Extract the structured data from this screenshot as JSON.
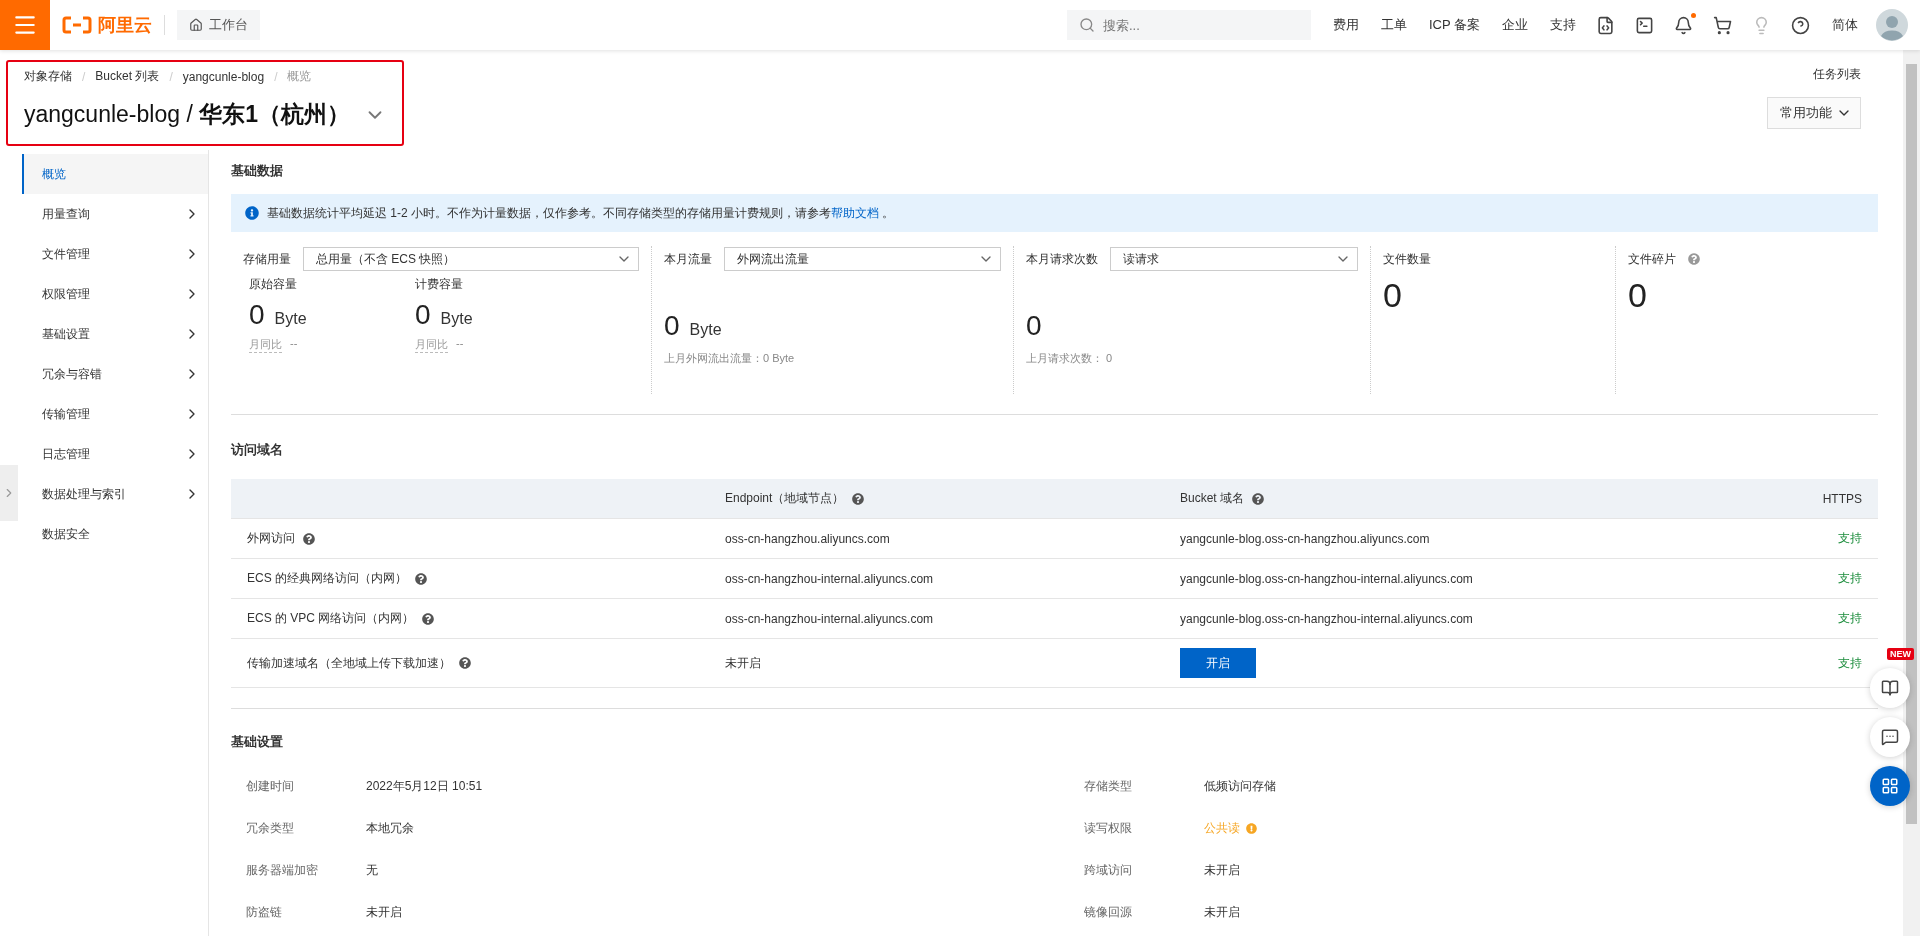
{
  "topbar": {
    "logo_text": "阿里云",
    "workbench": "工作台",
    "search": {
      "placeholder": "搜索..."
    },
    "links": [
      "费用",
      "工单",
      "ICP 备案",
      "企业",
      "支持"
    ],
    "notification": true,
    "language": "简体"
  },
  "breadcrumb_separator": "/",
  "breadcrumb": [
    {
      "label": "对象存储",
      "current": false
    },
    {
      "label": "Bucket 列表",
      "current": false
    },
    {
      "label": "yangcunle-blog",
      "current": false
    },
    {
      "label": "概览",
      "current": true
    }
  ],
  "title": "yangcunle-blog / **华东1（杭州）**",
  "task_list": "任务列表",
  "common_functions": "常用功能",
  "sidebar": {
    "items": [
      {
        "label": "概览",
        "selected": true,
        "expandable": false
      },
      {
        "label": "用量查询",
        "selected": false,
        "expandable": true
      },
      {
        "label": "文件管理",
        "selected": false,
        "expandable": true
      },
      {
        "label": "权限管理",
        "selected": false,
        "expandable": true
      },
      {
        "label": "基础设置",
        "selected": false,
        "expandable": true
      },
      {
        "label": "冗余与容错",
        "selected": false,
        "expandable": true
      },
      {
        "label": "传输管理",
        "selected": false,
        "expandable": true
      },
      {
        "label": "日志管理",
        "selected": false,
        "expandable": true
      },
      {
        "label": "数据处理与索引",
        "selected": false,
        "expandable": true
      },
      {
        "label": "数据安全",
        "selected": false,
        "expandable": false
      }
    ]
  },
  "basic_data": {
    "title": "基础数据",
    "notice": {
      "text": "基础数据统计平均延迟 1-2 小时。不作为计量数据，仅作参考。不同存储类型的存储用量计费规则，请参考",
      "link": "帮助文档",
      "suffix": " 。"
    },
    "stats": [
      {
        "kind": "split",
        "label": "存储用量",
        "select": "总用量（不含 ECS 快照）",
        "metrics": [
          {
            "label": "原始容量",
            "value": "0",
            "unit": "Byte",
            "compare_label": "月同比",
            "compare": "--"
          },
          {
            "label": "计费容量",
            "value": "0",
            "unit": "Byte",
            "compare_label": "月同比",
            "compare": "--"
          }
        ]
      },
      {
        "kind": "select",
        "label": "本月流量",
        "select": "外网流出流量",
        "value": "0",
        "unit": "Byte",
        "footnote": "上月外网流出流量：0 Byte"
      },
      {
        "kind": "select",
        "label": "本月请求次数",
        "select": "读请求",
        "value": "0",
        "footnote": "上月请求次数：  0"
      },
      {
        "kind": "plain",
        "label": "文件数量",
        "help": false,
        "value": "0"
      },
      {
        "kind": "plain",
        "label": "文件碎片",
        "help": true,
        "value": "0"
      }
    ]
  },
  "domains": {
    "title": "访问域名",
    "columns": [
      {
        "label": "Endpoint（地域节点）",
        "help": true
      },
      {
        "label": "Bucket 域名",
        "help": true
      },
      {
        "label": "HTTPS",
        "help": false
      }
    ],
    "rows": [
      {
        "name": "外网访问",
        "endpoint": "oss-cn-hangzhou.aliyuncs.com",
        "bucket": {
          "kind": "text",
          "text": "yangcunle-blog.oss-cn-hangzhou.aliyuncs.com"
        },
        "https": "支持"
      },
      {
        "name": "ECS 的经典网络访问（内网）",
        "endpoint": "oss-cn-hangzhou-internal.aliyuncs.com",
        "bucket": {
          "kind": "text",
          "text": "yangcunle-blog.oss-cn-hangzhou-internal.aliyuncs.com"
        },
        "https": "支持"
      },
      {
        "name": "ECS 的 VPC 网络访问（内网）",
        "endpoint": "oss-cn-hangzhou-internal.aliyuncs.com",
        "bucket": {
          "kind": "text",
          "text": "yangcunle-blog.oss-cn-hangzhou-internal.aliyuncs.com"
        },
        "https": "支持"
      },
      {
        "name": "传输加速域名（全地域上传下载加速）",
        "endpoint": "未开启",
        "bucket": {
          "kind": "button",
          "text": "开启"
        },
        "https": "支持"
      }
    ]
  },
  "settings": {
    "title": "基础设置",
    "items": [
      {
        "label": "创建时间",
        "value": "2022年5月12日 10:51",
        "warning": false
      },
      {
        "label": "存储类型",
        "value": "低频访问存储",
        "warning": false
      },
      {
        "label": "冗余类型",
        "value": "本地冗余",
        "warning": false
      },
      {
        "label": "读写权限",
        "value": "公共读",
        "warning": true
      },
      {
        "label": "服务器端加密",
        "value": "无",
        "warning": false
      },
      {
        "label": "跨域访问",
        "value": "未开启",
        "warning": false
      },
      {
        "label": "防盗链",
        "value": "未开启",
        "warning": false
      },
      {
        "label": "镜像回源",
        "value": "未开启",
        "warning": false
      }
    ]
  },
  "floating": {
    "badge": "NEW"
  }
}
